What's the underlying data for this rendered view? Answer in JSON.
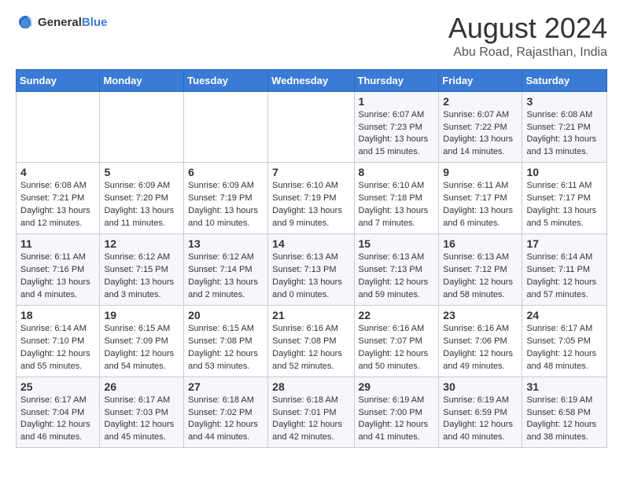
{
  "header": {
    "logo_general": "General",
    "logo_blue": "Blue",
    "month_title": "August 2024",
    "location": "Abu Road, Rajasthan, India"
  },
  "days_of_week": [
    "Sunday",
    "Monday",
    "Tuesday",
    "Wednesday",
    "Thursday",
    "Friday",
    "Saturday"
  ],
  "weeks": [
    [
      {
        "day": "",
        "info": ""
      },
      {
        "day": "",
        "info": ""
      },
      {
        "day": "",
        "info": ""
      },
      {
        "day": "",
        "info": ""
      },
      {
        "day": "1",
        "info": "Sunrise: 6:07 AM\nSunset: 7:23 PM\nDaylight: 13 hours\nand 15 minutes."
      },
      {
        "day": "2",
        "info": "Sunrise: 6:07 AM\nSunset: 7:22 PM\nDaylight: 13 hours\nand 14 minutes."
      },
      {
        "day": "3",
        "info": "Sunrise: 6:08 AM\nSunset: 7:21 PM\nDaylight: 13 hours\nand 13 minutes."
      }
    ],
    [
      {
        "day": "4",
        "info": "Sunrise: 6:08 AM\nSunset: 7:21 PM\nDaylight: 13 hours\nand 12 minutes."
      },
      {
        "day": "5",
        "info": "Sunrise: 6:09 AM\nSunset: 7:20 PM\nDaylight: 13 hours\nand 11 minutes."
      },
      {
        "day": "6",
        "info": "Sunrise: 6:09 AM\nSunset: 7:19 PM\nDaylight: 13 hours\nand 10 minutes."
      },
      {
        "day": "7",
        "info": "Sunrise: 6:10 AM\nSunset: 7:19 PM\nDaylight: 13 hours\nand 9 minutes."
      },
      {
        "day": "8",
        "info": "Sunrise: 6:10 AM\nSunset: 7:18 PM\nDaylight: 13 hours\nand 7 minutes."
      },
      {
        "day": "9",
        "info": "Sunrise: 6:11 AM\nSunset: 7:17 PM\nDaylight: 13 hours\nand 6 minutes."
      },
      {
        "day": "10",
        "info": "Sunrise: 6:11 AM\nSunset: 7:17 PM\nDaylight: 13 hours\nand 5 minutes."
      }
    ],
    [
      {
        "day": "11",
        "info": "Sunrise: 6:11 AM\nSunset: 7:16 PM\nDaylight: 13 hours\nand 4 minutes."
      },
      {
        "day": "12",
        "info": "Sunrise: 6:12 AM\nSunset: 7:15 PM\nDaylight: 13 hours\nand 3 minutes."
      },
      {
        "day": "13",
        "info": "Sunrise: 6:12 AM\nSunset: 7:14 PM\nDaylight: 13 hours\nand 2 minutes."
      },
      {
        "day": "14",
        "info": "Sunrise: 6:13 AM\nSunset: 7:13 PM\nDaylight: 13 hours\nand 0 minutes."
      },
      {
        "day": "15",
        "info": "Sunrise: 6:13 AM\nSunset: 7:13 PM\nDaylight: 12 hours\nand 59 minutes."
      },
      {
        "day": "16",
        "info": "Sunrise: 6:13 AM\nSunset: 7:12 PM\nDaylight: 12 hours\nand 58 minutes."
      },
      {
        "day": "17",
        "info": "Sunrise: 6:14 AM\nSunset: 7:11 PM\nDaylight: 12 hours\nand 57 minutes."
      }
    ],
    [
      {
        "day": "18",
        "info": "Sunrise: 6:14 AM\nSunset: 7:10 PM\nDaylight: 12 hours\nand 55 minutes."
      },
      {
        "day": "19",
        "info": "Sunrise: 6:15 AM\nSunset: 7:09 PM\nDaylight: 12 hours\nand 54 minutes."
      },
      {
        "day": "20",
        "info": "Sunrise: 6:15 AM\nSunset: 7:08 PM\nDaylight: 12 hours\nand 53 minutes."
      },
      {
        "day": "21",
        "info": "Sunrise: 6:16 AM\nSunset: 7:08 PM\nDaylight: 12 hours\nand 52 minutes."
      },
      {
        "day": "22",
        "info": "Sunrise: 6:16 AM\nSunset: 7:07 PM\nDaylight: 12 hours\nand 50 minutes."
      },
      {
        "day": "23",
        "info": "Sunrise: 6:16 AM\nSunset: 7:06 PM\nDaylight: 12 hours\nand 49 minutes."
      },
      {
        "day": "24",
        "info": "Sunrise: 6:17 AM\nSunset: 7:05 PM\nDaylight: 12 hours\nand 48 minutes."
      }
    ],
    [
      {
        "day": "25",
        "info": "Sunrise: 6:17 AM\nSunset: 7:04 PM\nDaylight: 12 hours\nand 46 minutes."
      },
      {
        "day": "26",
        "info": "Sunrise: 6:17 AM\nSunset: 7:03 PM\nDaylight: 12 hours\nand 45 minutes."
      },
      {
        "day": "27",
        "info": "Sunrise: 6:18 AM\nSunset: 7:02 PM\nDaylight: 12 hours\nand 44 minutes."
      },
      {
        "day": "28",
        "info": "Sunrise: 6:18 AM\nSunset: 7:01 PM\nDaylight: 12 hours\nand 42 minutes."
      },
      {
        "day": "29",
        "info": "Sunrise: 6:19 AM\nSunset: 7:00 PM\nDaylight: 12 hours\nand 41 minutes."
      },
      {
        "day": "30",
        "info": "Sunrise: 6:19 AM\nSunset: 6:59 PM\nDaylight: 12 hours\nand 40 minutes."
      },
      {
        "day": "31",
        "info": "Sunrise: 6:19 AM\nSunset: 6:58 PM\nDaylight: 12 hours\nand 38 minutes."
      }
    ]
  ]
}
